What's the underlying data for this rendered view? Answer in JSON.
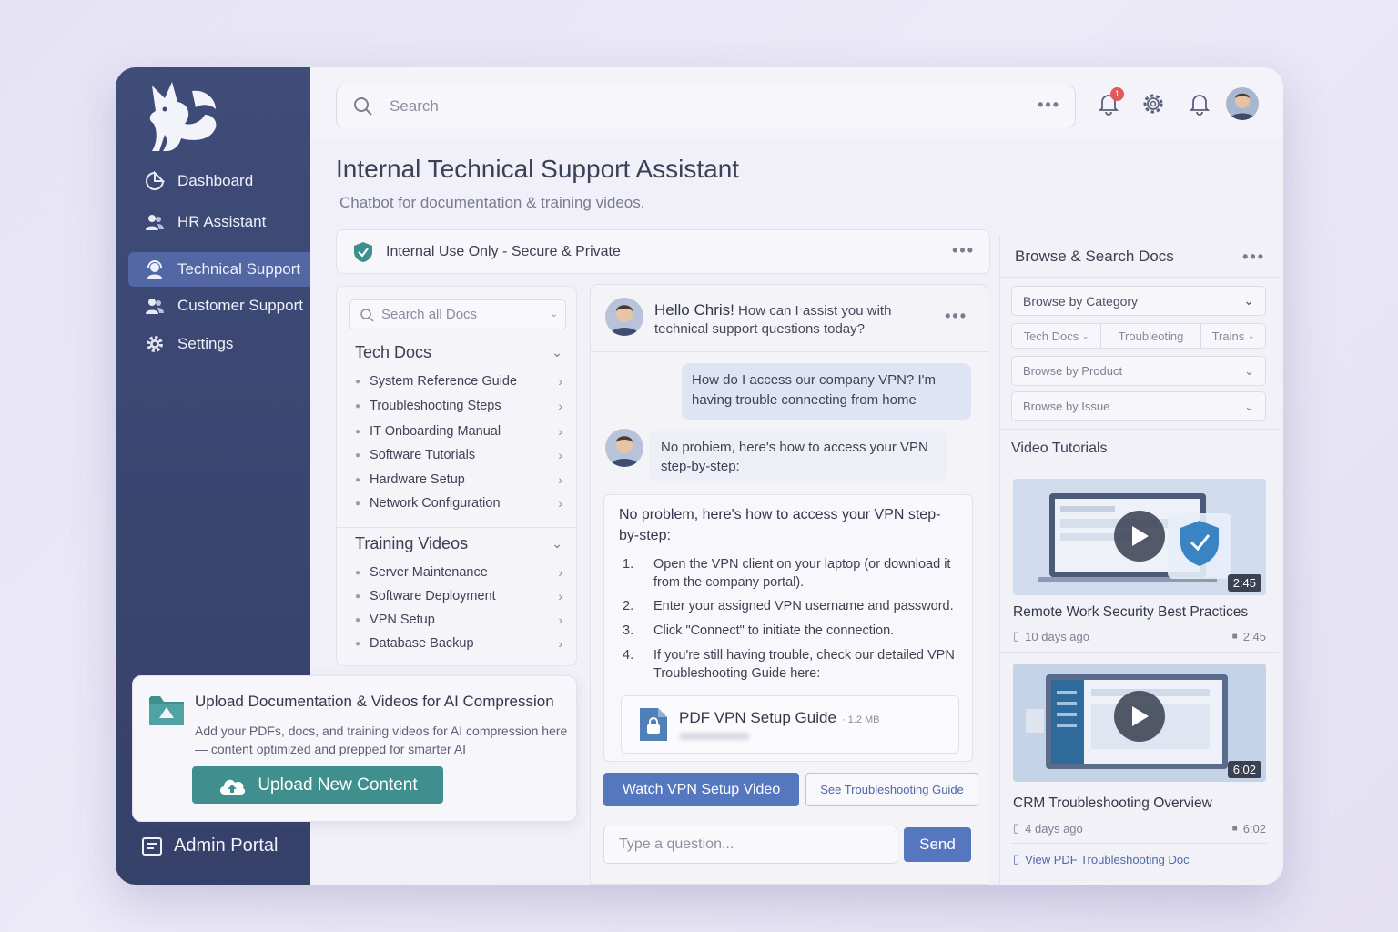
{
  "sidebar": {
    "items": [
      {
        "label": "Dashboard",
        "icon": "dashboard-icon"
      },
      {
        "label": "HR Assistant",
        "icon": "users-icon"
      },
      {
        "label": "Technical Support",
        "icon": "support-agent-icon",
        "active": true
      },
      {
        "label": "Customer Support",
        "icon": "users-icon"
      },
      {
        "label": "Settings",
        "icon": "gear-icon"
      }
    ],
    "admin_label": "Admin Portal"
  },
  "topbar": {
    "search_placeholder": "Search",
    "notification_count": "1"
  },
  "page": {
    "title": "Internal Technical Support Assistant",
    "subtitle": "Chatbot for documentation & training videos."
  },
  "secure_banner": {
    "label": "Internal Use Only - Secure & Private"
  },
  "docs": {
    "search_placeholder": "Search all Docs",
    "tech_docs": {
      "title": "Tech Docs",
      "items": [
        "System Reference Guide",
        "Troubleshooting Steps",
        "IT Onboarding Manual",
        "Software Tutorials",
        "Hardware Setup",
        "Network Configuration"
      ]
    },
    "training_videos": {
      "title": "Training Videos",
      "items": [
        "Server Maintenance",
        "Software Deployment",
        "VPN Setup",
        "Database Backup"
      ]
    }
  },
  "upload": {
    "title": "Upload Documentation & Videos for AI Compression",
    "description": "Add your PDFs, docs, and training videos for AI compression here — content optimized and prepped for smarter AI",
    "button": "Upload New Content"
  },
  "chat": {
    "greeting_hello": "Hello Chris!",
    "greeting_rest": "How can I assist you with technical support questions today?",
    "user_message": "How do I access our company VPN? I'm having trouble connecting from home",
    "bot_message": "No probiem, here's how to access your VPN step-by-step:",
    "answer_intro": "No problem, here's how to access your VPN step-by-step:",
    "steps": [
      {
        "n": "1.",
        "text": "Open the VPN client on your laptop (or download it from the company portal)."
      },
      {
        "n": "2.",
        "text": "Enter your assigned VPN username and password."
      },
      {
        "n": "3.",
        "text": "Click \"Connect\" to initiate the connection."
      },
      {
        "n": "4.",
        "text": "If you're still having trouble, check our detailed VPN Troubleshooting Guide here:"
      }
    ],
    "pdf_name": "PDF VPN Setup Guide",
    "pdf_size": "· 1.2 MB",
    "watch_button": "Watch VPN Setup Video",
    "guide_button": "See Troubleshooting Guide",
    "input_placeholder": "Type a question...",
    "send_button": "Send"
  },
  "right": {
    "title": "Browse & Search Docs",
    "browse_category": "Browse by Category",
    "filters": [
      "Tech Docs",
      "Troubleoting",
      "Trains"
    ],
    "browse_product": "Browse by Product",
    "browse_issue": "Browse by Issue",
    "video_heading": "Video Tutorials",
    "videos": [
      {
        "title": "Remote Work Security Best Practices",
        "age": "10 days ago",
        "duration": "2:45"
      },
      {
        "title": "CRM Troubleshooting Overview",
        "age": "4 days ago",
        "duration": "6:02"
      }
    ],
    "pdf_link": "View PDF Troubleshooting Doc"
  },
  "colors": {
    "sidebar": "#3f4c78",
    "accent": "#5577bf",
    "upload_button": "#3f8f8f"
  }
}
